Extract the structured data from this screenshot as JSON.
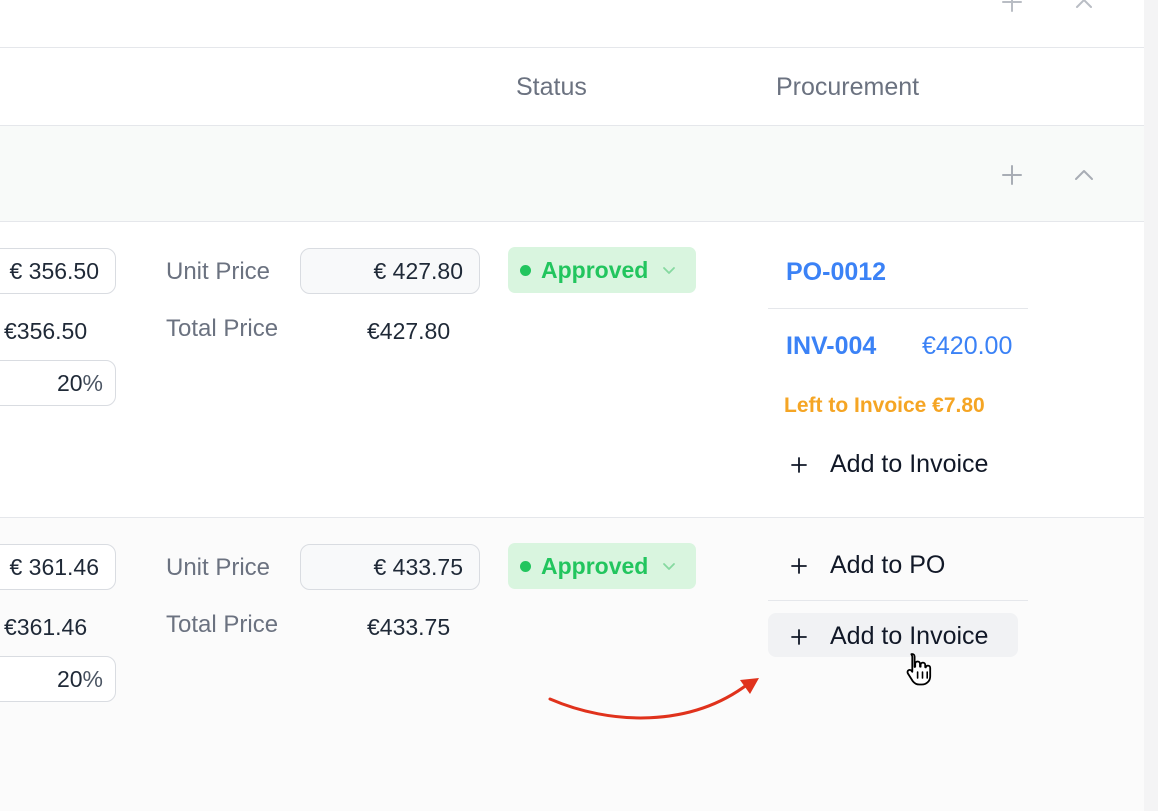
{
  "header": {
    "status": "Status",
    "procurement": "Procurement"
  },
  "rows": [
    {
      "cost_unit": "€ 356.50",
      "cost_total": "€356.50",
      "margin_value": "20",
      "margin_unit": "%",
      "unit_price_label": "Unit Price",
      "unit_price_value": "€ 427.80",
      "total_price_label": "Total Price",
      "total_price_value": "€427.80",
      "status": "Approved",
      "po_link": "PO-0012",
      "invoice_link": "INV-004",
      "invoice_amount": "€420.00",
      "left_to_invoice": "Left to Invoice €7.80",
      "add_invoice_label": "Add to Invoice"
    },
    {
      "cost_unit": "€ 361.46",
      "cost_total": "€361.46",
      "margin_value": "20",
      "margin_unit": "%",
      "unit_price_label": "Unit Price",
      "unit_price_value": "€ 433.75",
      "total_price_label": "Total Price",
      "total_price_value": "€433.75",
      "status": "Approved",
      "add_po_label": "Add to PO",
      "add_invoice_label": "Add to Invoice"
    }
  ],
  "colors": {
    "accent": "#3b82f6",
    "approved_bg": "#d9f5df",
    "approved_text": "#22c55e",
    "warning": "#f5a524",
    "arrow": "#e0321c"
  },
  "icons": [
    "plus-icon",
    "close-icon",
    "chevron-up-icon",
    "chevron-down-icon",
    "hand-cursor-icon"
  ]
}
